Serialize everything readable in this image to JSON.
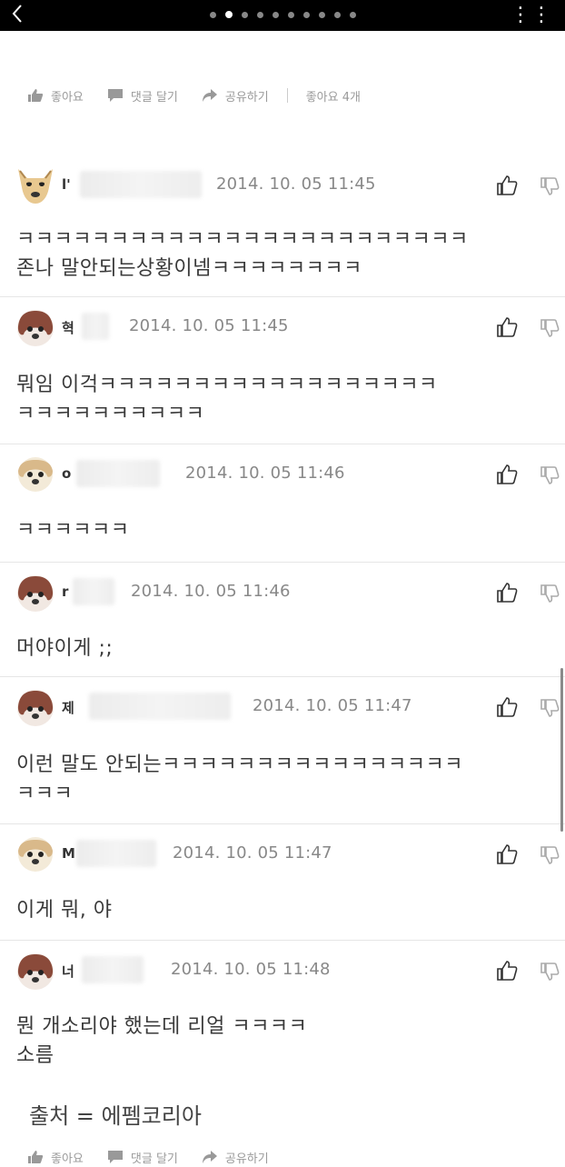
{
  "topbar": {
    "back_icon": "chevron-left-icon",
    "page_count": 10,
    "active_page": 2,
    "more_icon": "more-dots-icon"
  },
  "actions": {
    "like": "좋아요",
    "comment": "댓글 달기",
    "share": "공유하기",
    "like_count": "좋아요 4개"
  },
  "comments": [
    {
      "user": "l'",
      "time": "2014. 10. 05  11:45",
      "text": "ㅋㅋㅋㅋㅋㅋㅋㅋㅋㅋㅋㅋㅋㅋㅋㅋㅋㅋㅋㅋㅋㅋㅋㅋ\n존나 말안되는상황이넴ㅋㅋㅋㅋㅋㅋㅋㅋ"
    },
    {
      "user": "혁",
      "time": "2014. 10. 05  11:45",
      "text": "뭐임 이걱ㅋㅋㅋㅋㅋㅋㅋㅋㅋㅋㅋㅋㅋㅋㅋㅋㅋㅋ\nㅋㅋㅋㅋㅋㅋㅋㅋㅋㅋ"
    },
    {
      "user": "o",
      "time": "2014. 10. 05  11:46",
      "text": "ㅋㅋㅋㅋㅋㅋ"
    },
    {
      "user": "r",
      "time": "2014. 10. 05  11:46",
      "text": "머야이게 ;;"
    },
    {
      "user": "제",
      "time": "2014. 10. 05  11:47",
      "text": "이런 말도 안되는ㅋㅋㅋㅋㅋㅋㅋㅋㅋㅋㅋㅋㅋㅋㅋㅋ\nㅋㅋㅋ"
    },
    {
      "user": "M",
      "time": "2014. 10. 05  11:47",
      "text": "이게 뭐, 야"
    },
    {
      "user": "너",
      "time": "2014. 10. 05  11:48",
      "text": "뭔 개소리야 했는데 리얼 ㅋㅋㅋㅋ\n소름"
    }
  ],
  "source": "출처 = 에펨코리아",
  "colors": {
    "topbar": "#000000",
    "divider": "#e6e6e6",
    "muted": "#9a9a9a"
  }
}
